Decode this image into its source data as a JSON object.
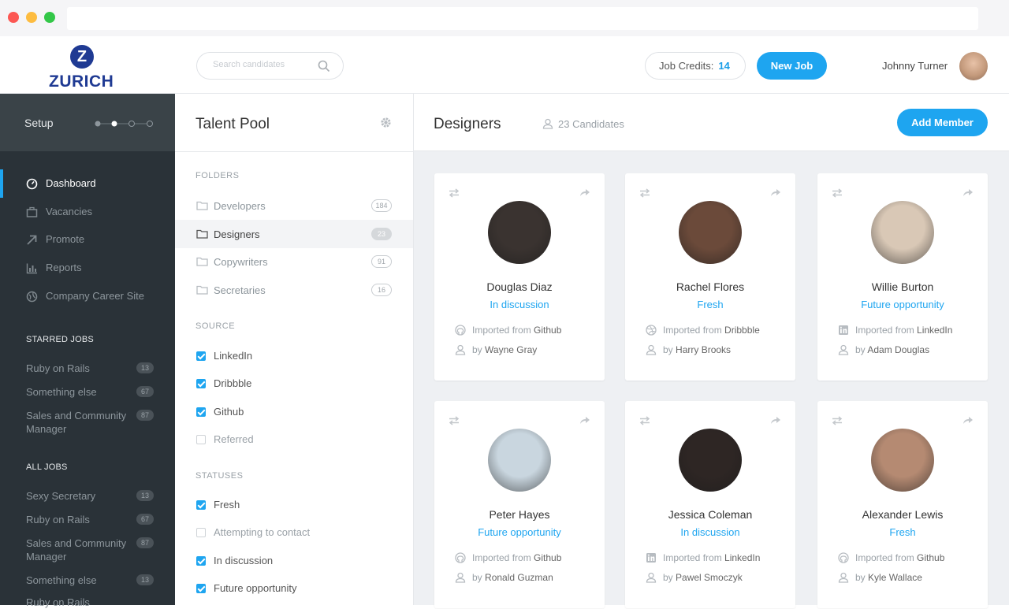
{
  "brand": {
    "logo_text": "ZURICH",
    "logo_mark": "Z"
  },
  "header": {
    "search_placeholder": "Search candidates",
    "credits_label": "Job Credits:",
    "credits_value": "14",
    "new_job_label": "New Job",
    "user_name": "Johnny Turner"
  },
  "sidebar": {
    "setup_label": "Setup",
    "nav": [
      {
        "label": "Dashboard",
        "icon": "dashboard-icon",
        "active": true
      },
      {
        "label": "Vacancies",
        "icon": "briefcase-icon"
      },
      {
        "label": "Promote",
        "icon": "arrow-up-right-icon"
      },
      {
        "label": "Reports",
        "icon": "bar-chart-icon"
      },
      {
        "label": "Company Career Site",
        "icon": "globe-icon"
      }
    ],
    "starred_heading": "STARRED JOBS",
    "starred": [
      {
        "label": "Ruby on Rails",
        "count": "13"
      },
      {
        "label": "Something else",
        "count": "67"
      },
      {
        "label": "Sales and Community Manager",
        "count": "87"
      }
    ],
    "all_heading": "ALL JOBS",
    "all": [
      {
        "label": "Sexy Secretary",
        "count": "13"
      },
      {
        "label": "Ruby on Rails",
        "count": "67"
      },
      {
        "label": "Sales and Community Manager",
        "count": "87"
      },
      {
        "label": "Something else",
        "count": "13"
      },
      {
        "label": "Ruby on Rails",
        "count": ""
      }
    ]
  },
  "panel": {
    "title": "Talent Pool",
    "folders_heading": "FOLDERS",
    "folders": [
      {
        "label": "Developers",
        "count": "184"
      },
      {
        "label": "Designers",
        "count": "23"
      },
      {
        "label": "Copywriters",
        "count": "91"
      },
      {
        "label": "Secretaries",
        "count": "16"
      }
    ],
    "source_heading": "SOURCE",
    "sources": [
      {
        "label": "LinkedIn",
        "checked": true
      },
      {
        "label": "Dribbble",
        "checked": true
      },
      {
        "label": "Github",
        "checked": true
      },
      {
        "label": "Referred",
        "checked": false
      }
    ],
    "statuses_heading": "STATUSES",
    "statuses": [
      {
        "label": "Fresh",
        "checked": true
      },
      {
        "label": "Attempting to contact",
        "checked": false
      },
      {
        "label": "In discussion",
        "checked": true
      },
      {
        "label": "Future opportunity",
        "checked": true
      }
    ]
  },
  "main": {
    "title": "Designers",
    "candidates_count": "23 Candidates",
    "add_member_label": "Add Member",
    "imported_prefix": "Imported from",
    "by_prefix": "by",
    "cards": [
      {
        "name": "Douglas Diaz",
        "status": "In discussion",
        "source": "Github",
        "by": "Wayne Gray",
        "source_icon": "github-icon",
        "avatar_color": "#3a3330"
      },
      {
        "name": "Rachel Flores",
        "status": "Fresh",
        "source": "Dribbble",
        "by": "Harry Brooks",
        "source_icon": "dribbble-icon",
        "avatar_color": "#6b4a3a"
      },
      {
        "name": "Willie Burton",
        "status": "Future opportunity",
        "source": "LinkedIn",
        "by": "Adam Douglas",
        "source_icon": "linkedin-icon",
        "avatar_color": "#d9c8b6"
      },
      {
        "name": "Peter Hayes",
        "status": "Future opportunity",
        "source": "Github",
        "by": "Ronald Guzman",
        "source_icon": "github-icon",
        "avatar_color": "#c9d6df"
      },
      {
        "name": "Jessica Coleman",
        "status": "In discussion",
        "source": "LinkedIn",
        "by": "Pawel Smoczyk",
        "source_icon": "linkedin-icon",
        "avatar_color": "#2e2624"
      },
      {
        "name": "Alexander Lewis",
        "status": "Fresh",
        "source": "Github",
        "by": "Kyle Wallace",
        "source_icon": "github-icon",
        "avatar_color": "#b58a72"
      }
    ]
  }
}
